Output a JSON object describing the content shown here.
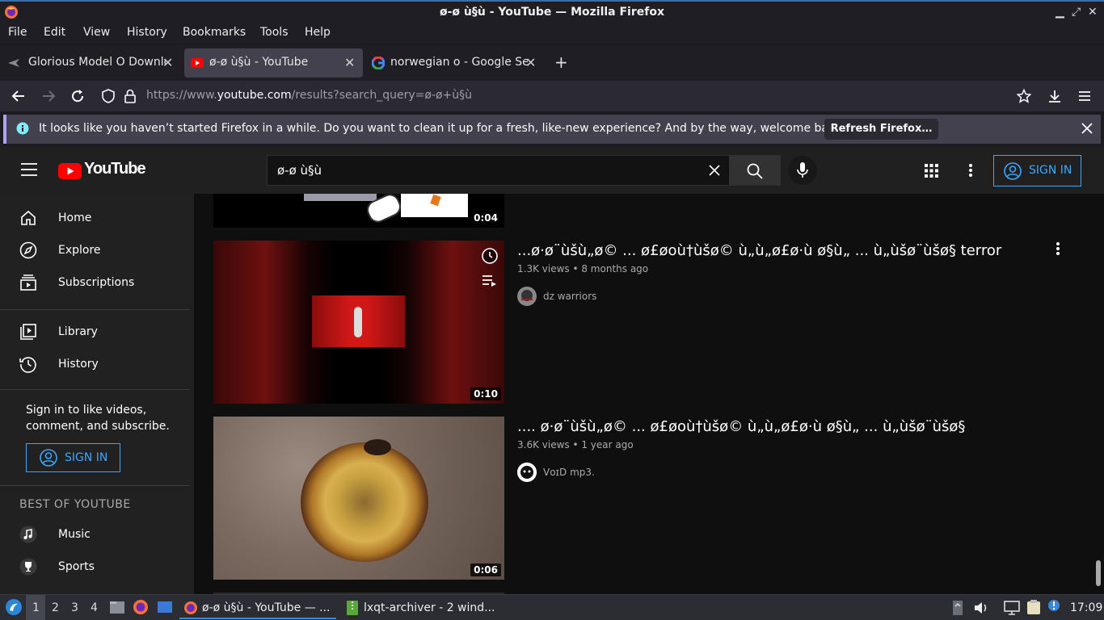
{
  "window": {
    "title": "ø-ø ù§ù - YouTube — Mozilla Firefox",
    "controls": [
      "▁",
      "⤢",
      "✕"
    ]
  },
  "menu": [
    "File",
    "Edit",
    "View",
    "History",
    "Bookmarks",
    "Tools",
    "Help"
  ],
  "tabs": [
    {
      "label": "Glorious Model O Downlo"
    },
    {
      "label": "ø-ø ù§ù - YouTube"
    },
    {
      "label": "norwegian o - Google Sea"
    }
  ],
  "address": {
    "prefix": "https://www.",
    "domain": "youtube.com",
    "path": "/results?search_query=ø-ø+ù§ù"
  },
  "notification": {
    "message": "It looks like you haven’t started Firefox in a while. Do you want to clean it up for a fresh, like-new experience? And by the way, welcome back!",
    "button": "Refresh Firefox…"
  },
  "youtube": {
    "logo": "YouTube",
    "search_query": "ø-ø ù§ù",
    "sign_in": "SIGN IN",
    "sidebar": {
      "main": [
        "Home",
        "Explore",
        "Subscriptions"
      ],
      "secondary": [
        "Library",
        "History"
      ],
      "signin_prompt": "Sign in to like videos, comment, and subscribe.",
      "signin_button": "SIGN IN",
      "best_heading": "BEST OF YOUTUBE",
      "best": [
        "Music",
        "Sports"
      ]
    },
    "videos": [
      {
        "duration": "0:04"
      },
      {
        "title": "...ø·ø¨ùšù„ø© ... ø£øoù†ùšø© ù„ù„ø£ø·ù ø§ù„ ... ù„ùšø¨ùšø§ terror",
        "meta": "1.3K views • 8 months ago",
        "channel": "dz warriors",
        "duration": "0:10"
      },
      {
        "title": ".... ø·ø¨ùšù„ø© ... ø£øoù†ùšø© ù„ù„ø£ø·ù ø§ù„ ... ù„ùšø¨ùšø§",
        "meta": "3.6K views • 1 year ago",
        "channel": "VᴏɪD mp3.",
        "duration": "0:06"
      }
    ]
  },
  "taskbar": {
    "workspaces": [
      "1",
      "2",
      "3",
      "4"
    ],
    "tasks": [
      "ø-ø ù§ù - YouTube — ...",
      "lxqt-archiver - 2 wind..."
    ],
    "clock": "17:09"
  },
  "colors": {
    "accent": "#3ea6ff",
    "yt_red": "#ff0000",
    "notif_border": "#b0a0ff"
  }
}
